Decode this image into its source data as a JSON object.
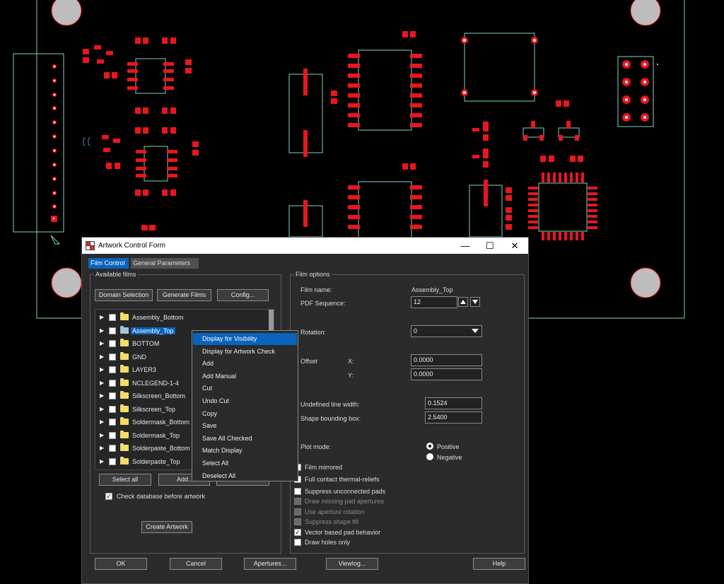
{
  "window": {
    "title": "Artwork Control Form",
    "minimize": "—",
    "maximize": "☐",
    "close": "✕"
  },
  "tabs": [
    {
      "label": "Film Control"
    },
    {
      "label": "General Parameters"
    }
  ],
  "available_films": {
    "group_label": "Available films",
    "buttons": {
      "domain_selection": "Domain Selection",
      "generate_films": "Generate Films",
      "config": "Config..."
    },
    "films": [
      {
        "name": "Assembly_Bottom"
      },
      {
        "name": "Assembly_Top",
        "selected": true
      },
      {
        "name": "BOTTOM"
      },
      {
        "name": "GND"
      },
      {
        "name": "LAYER3"
      },
      {
        "name": "NCLEGEND-1-4"
      },
      {
        "name": "Silkscreen_Bottom"
      },
      {
        "name": "Silkscreen_Top"
      },
      {
        "name": "Soldermask_Bottom"
      },
      {
        "name": "Soldermask_Top"
      },
      {
        "name": "Solderpaste_Bottom"
      },
      {
        "name": "Solderpaste_Top"
      }
    ],
    "select_all": "Select all",
    "add": "Add...",
    "check_database": "Check database before artwork",
    "check_database_checked": true,
    "create_artwork": "Create Artwork"
  },
  "context_menu": {
    "items": [
      {
        "label": "Display for Visibility",
        "highlighted": true
      },
      {
        "label": "Display for Artwork Check"
      },
      {
        "label": "Add"
      },
      {
        "label": "Add Manual"
      },
      {
        "label": "Cut"
      },
      {
        "label": "Undo Cut"
      },
      {
        "label": "Copy"
      },
      {
        "label": "Save"
      },
      {
        "label": "Save All Checked"
      },
      {
        "label": "Match Display"
      },
      {
        "label": "Select All"
      },
      {
        "label": "Deselect All"
      }
    ]
  },
  "film_options": {
    "group_label": "Film options",
    "film_name_label": "Film name:",
    "film_name_value": "Assembly_Top",
    "pdf_sequence_label": "PDF Sequence:",
    "pdf_sequence_value": "12",
    "rotation_label": "Rotation:",
    "rotation_value": "0",
    "offset_label": "Offset",
    "offset_x_label": "X:",
    "offset_x_value": "0.0000",
    "offset_y_label": "Y:",
    "offset_y_value": "0.0000",
    "undefined_line_width_label": "Undefined line width:",
    "undefined_line_width_value": "0.1524",
    "shape_bounding_box_label": "Shape bounding box:",
    "shape_bounding_box_value": "2.5400",
    "plot_mode_label": "Plot mode:",
    "plot_mode_positive": "Positive",
    "plot_mode_negative": "Negative",
    "plot_mode_selected": "Positive",
    "checkboxes": [
      {
        "label": "Film mirrored",
        "checked": false,
        "enabled": true
      },
      {
        "label": "Full contact thermal-reliefs",
        "checked": false,
        "enabled": true
      },
      {
        "label": "Suppress unconnected pads",
        "checked": false,
        "enabled": true
      },
      {
        "label": "Draw missing pad apertures",
        "checked": false,
        "enabled": false
      },
      {
        "label": "Use aperture rotation",
        "checked": false,
        "enabled": false
      },
      {
        "label": "Suppress shape fill",
        "checked": false,
        "enabled": false
      },
      {
        "label": "Vector based pad behavior",
        "checked": true,
        "enabled": true
      },
      {
        "label": "Draw holes only",
        "checked": false,
        "enabled": true
      }
    ]
  },
  "bottom_buttons": {
    "ok": "OK",
    "cancel": "Cancel",
    "apertures": "Apertures...",
    "viewlog": "Viewlog...",
    "help": "Help"
  },
  "colors": {
    "pcb_background": "#000000",
    "pad_red": "#e8161e",
    "outline_teal": "#7fd3c3",
    "selection_blue": "#0a63bd",
    "mounting_hole": "#bdbdbd"
  }
}
